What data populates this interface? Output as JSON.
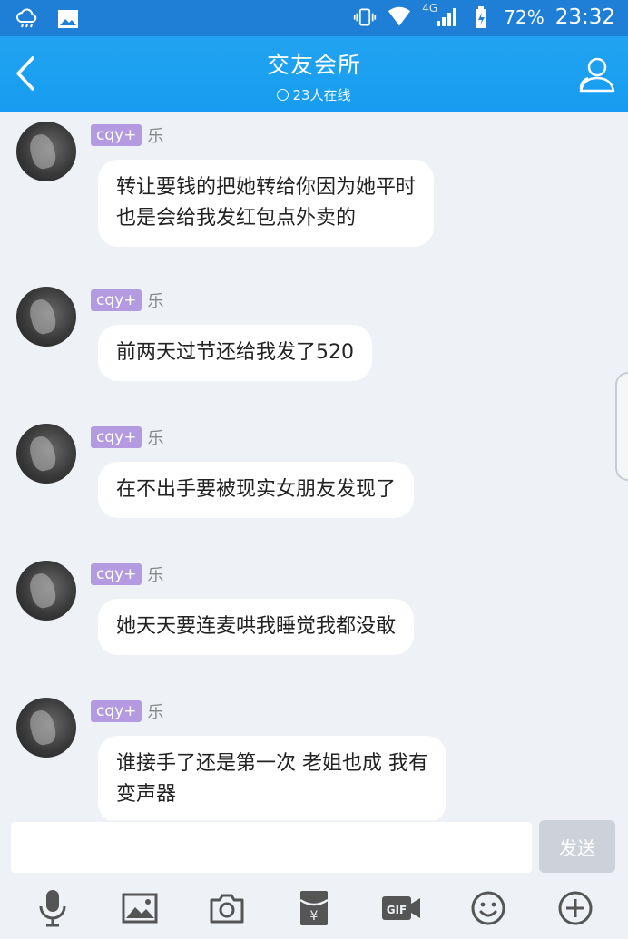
{
  "status_bar": {
    "network": "4G",
    "battery": "72%",
    "time": "23:32"
  },
  "header": {
    "title": "交友会所",
    "online": "23人在线"
  },
  "messages": [
    {
      "badge": "cqy+",
      "nick": "乐",
      "text_lines": [
        "转让要钱的把她转给你因为她平时",
        "也是会给我发红包点外卖的"
      ]
    },
    {
      "badge": "cqy+",
      "nick": "乐",
      "text_lines": [
        "前两天过节还给我发了520"
      ]
    },
    {
      "badge": "cqy+",
      "nick": "乐",
      "text_lines": [
        "在不出手要被现实女朋友发现了"
      ]
    },
    {
      "badge": "cqy+",
      "nick": "乐",
      "text_lines": [
        "她天天要连麦哄我睡觉我都没敢"
      ]
    },
    {
      "badge": "cqy+",
      "nick": "乐",
      "text_lines": [
        "谁接手了还是第一次 老姐也成 我有",
        "变声器"
      ]
    }
  ],
  "input": {
    "value": "",
    "send_label": "发送"
  },
  "toolbar": {
    "icons": [
      "microphone-icon",
      "image-icon",
      "camera-icon",
      "red-packet-icon",
      "gif-icon",
      "emoji-icon",
      "plus-icon"
    ]
  },
  "colors": {
    "header": "#169cf0",
    "badge": "#b49ae0",
    "background": "#eef1f6"
  }
}
